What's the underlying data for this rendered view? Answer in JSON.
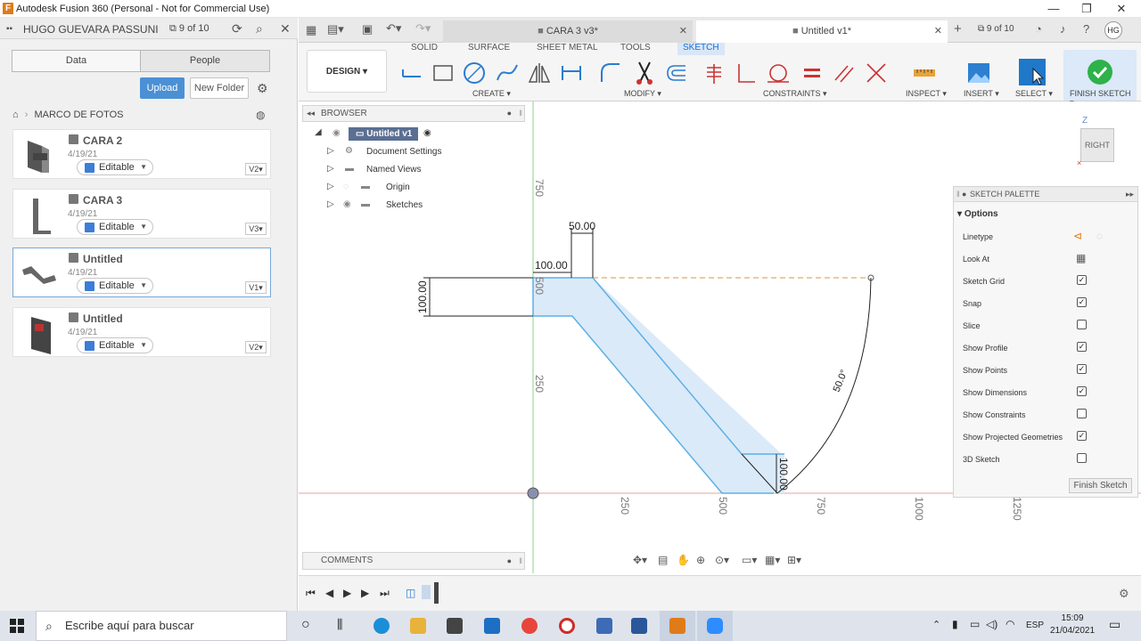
{
  "window": {
    "title": "Autodesk Fusion 360 (Personal - Not for Commercial Use)"
  },
  "left_panel": {
    "user": "HUGO GUEVARA PASSUNI",
    "version_count": "9 of 10",
    "tabs": [
      "Data",
      "People"
    ],
    "upload_label": "Upload",
    "new_folder_label": "New Folder",
    "breadcrumb": "MARCO DE FOTOS",
    "files": [
      {
        "name": "CARA 2",
        "date": "4/19/21",
        "status": "Editable",
        "version": "V2"
      },
      {
        "name": "CARA 3",
        "date": "4/19/21",
        "status": "Editable",
        "version": "V3"
      },
      {
        "name": "Untitled",
        "date": "4/19/21",
        "status": "Editable",
        "version": "V1"
      },
      {
        "name": "Untitled",
        "date": "4/19/21",
        "status": "Editable",
        "version": "V2"
      }
    ]
  },
  "document_tabs": [
    {
      "label": "CARA 3 v3*"
    },
    {
      "label": "Untitled v1*"
    }
  ],
  "tabbar_right": {
    "version_count": "9 of 10",
    "user_initials": "HG"
  },
  "ribbon": {
    "tabs": [
      "SOLID",
      "SURFACE",
      "SHEET METAL",
      "TOOLS",
      "SKETCH"
    ],
    "workspace": "DESIGN",
    "groups": [
      "CREATE",
      "MODIFY",
      "CONSTRAINTS",
      "INSPECT",
      "INSERT",
      "SELECT",
      "FINISH SKETCH"
    ]
  },
  "browser": {
    "title": "BROWSER",
    "root": "Untitled v1",
    "items": [
      "Document Settings",
      "Named Views",
      "Origin",
      "Sketches"
    ]
  },
  "viewcube": {
    "face": "RIGHT",
    "axis": "Z"
  },
  "sketch": {
    "dimensions": [
      "50.00",
      "100.00",
      "100.00",
      "100.00",
      "50.0°"
    ],
    "axis_labels_vertical": [
      "750",
      "500",
      "250"
    ],
    "axis_labels_horizontal": [
      "250",
      "500",
      "750",
      "1000",
      "1250"
    ]
  },
  "palette": {
    "title": "SKETCH PALETTE",
    "section": "Options",
    "options": [
      {
        "label": "Linetype",
        "type": "icons"
      },
      {
        "label": "Look At",
        "type": "icon"
      },
      {
        "label": "Sketch Grid",
        "checked": true
      },
      {
        "label": "Snap",
        "checked": true
      },
      {
        "label": "Slice",
        "checked": false
      },
      {
        "label": "Show Profile",
        "checked": true
      },
      {
        "label": "Show Points",
        "checked": true
      },
      {
        "label": "Show Dimensions",
        "checked": true
      },
      {
        "label": "Show Constraints",
        "checked": false
      },
      {
        "label": "Show Projected Geometries",
        "checked": true
      },
      {
        "label": "3D Sketch",
        "checked": false
      }
    ],
    "finish_label": "Finish Sketch"
  },
  "comments": {
    "label": "COMMENTS"
  },
  "taskbar": {
    "search_placeholder": "Escribe aquí para buscar",
    "language": "ESP",
    "time": "15:09",
    "date": "21/04/2021"
  }
}
